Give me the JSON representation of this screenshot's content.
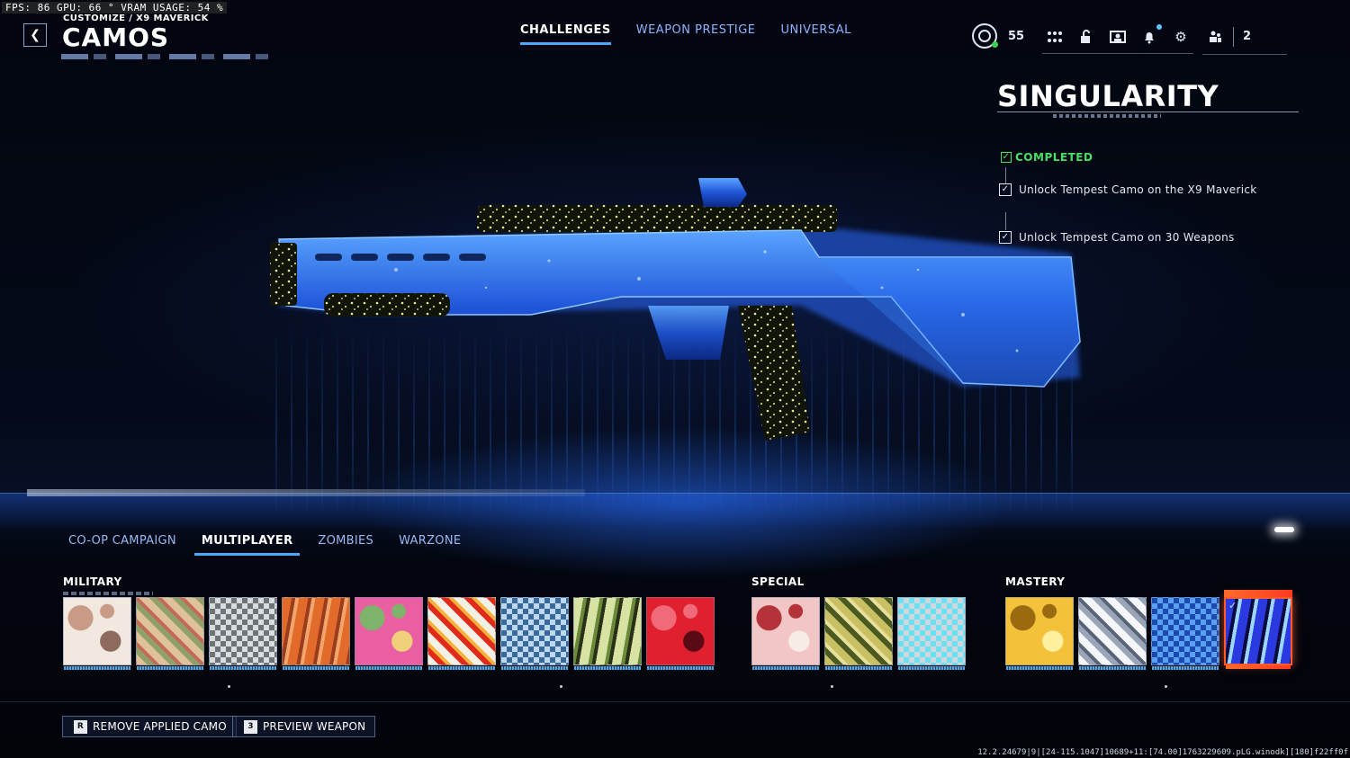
{
  "debug_overlay": "FPS:  86  GPU: 66 °  VRAM USAGE: 54 %",
  "header": {
    "breadcrumb": "CUSTOMIZE / X9 MAVERICK",
    "title": "CAMOS",
    "tabs": [
      {
        "label": "CHALLENGES",
        "active": true
      },
      {
        "label": "WEAPON PRESTIGE",
        "active": false
      },
      {
        "label": "UNIVERSAL",
        "active": false
      }
    ],
    "player_level": "55",
    "party_count": "2",
    "icons": [
      "apps-grid-icon",
      "lock-icon",
      "barracks-icon",
      "notification-bell-icon",
      "settings-gear-icon"
    ]
  },
  "camo_detail": {
    "name": "SINGULARITY",
    "status": "COMPLETED",
    "status_color": "#47e067",
    "challenges": [
      {
        "text": "Unlock Tempest Camo on the X9 Maverick",
        "checked": true
      },
      {
        "text": "Unlock Tempest Camo on 30 Weapons",
        "checked": true
      }
    ]
  },
  "mode_tabs": [
    {
      "label": "CO-OP CAMPAIGN",
      "active": false
    },
    {
      "label": "MULTIPLAYER",
      "active": true
    },
    {
      "label": "ZOMBIES",
      "active": false
    },
    {
      "label": "WARZONE",
      "active": false
    }
  ],
  "camo_categories": [
    {
      "label": "MILITARY",
      "tiles": [
        {
          "pattern": "arctic-camo",
          "colors": [
            "#f1e8e0",
            "#c99a86",
            "#8e6a5e"
          ]
        },
        {
          "pattern": "woodland-camo",
          "colors": [
            "#e0c29a",
            "#8fa168",
            "#c56a5a"
          ]
        },
        {
          "pattern": "digital-camo",
          "colors": [
            "#d9dcdc",
            "#6e7378",
            "#2e3236"
          ]
        },
        {
          "pattern": "bark-camo",
          "colors": [
            "#e26a2a",
            "#9a3c1e",
            "#f2a56a"
          ]
        },
        {
          "pattern": "jungle-camo",
          "colors": [
            "#e95fa2",
            "#7fb26a",
            "#f0d07a"
          ]
        },
        {
          "pattern": "marble-camo",
          "colors": [
            "#f4f0e6",
            "#e02a1a",
            "#f3b23a"
          ]
        },
        {
          "pattern": "shard-camo",
          "colors": [
            "#bcd8f0",
            "#3a6a9a",
            "#1e2430"
          ]
        },
        {
          "pattern": "tiger-camo",
          "colors": [
            "#d8e2a2",
            "#6a8a3a",
            "#2a3018"
          ]
        },
        {
          "pattern": "speckle-camo",
          "colors": [
            "#e0202e",
            "#f06a7a",
            "#5a0a14"
          ]
        }
      ]
    },
    {
      "label": "SPECIAL",
      "tiles": [
        {
          "pattern": "coral-camo",
          "colors": [
            "#f2c6c6",
            "#b4323a",
            "#f8ece6"
          ]
        },
        {
          "pattern": "reptile-camo",
          "colors": [
            "#c8c062",
            "#4a5a22",
            "#e8e09a"
          ]
        },
        {
          "pattern": "tech-camo",
          "colors": [
            "#cfd6de",
            "#6ae0f0",
            "#3a4250"
          ]
        }
      ]
    },
    {
      "label": "MASTERY",
      "tiles": [
        {
          "pattern": "gold-shatter-camo",
          "colors": [
            "#f3c23a",
            "#9a6a10",
            "#fff0a0"
          ]
        },
        {
          "pattern": "diamond-camo",
          "colors": [
            "#f4f6fa",
            "#9aa6b8",
            "#5a6478"
          ]
        },
        {
          "pattern": "tempest-camo",
          "colors": [
            "#5aa0f0",
            "#1a4ab0",
            "#e0f0ff"
          ]
        },
        {
          "pattern": "singularity-camo",
          "colors": [
            "#2a3ae0",
            "#0a0c40",
            "#9ad6ff"
          ],
          "selected": true,
          "equipped": true
        }
      ]
    }
  ],
  "actions": [
    {
      "key": "R",
      "label": "REMOVE APPLIED CAMO"
    },
    {
      "key": "3",
      "label": "PREVIEW WEAPON"
    }
  ],
  "build_string": "12.2.24679|9|[24-115.1047]10689+11:[74.00]1763229609.pLG.winodk][180]f22ff0f",
  "accent_colors": {
    "tab_active": "#4aa8ff",
    "selected_tile": "#ff5a2c",
    "weapon_glow": "#2f7bff"
  }
}
